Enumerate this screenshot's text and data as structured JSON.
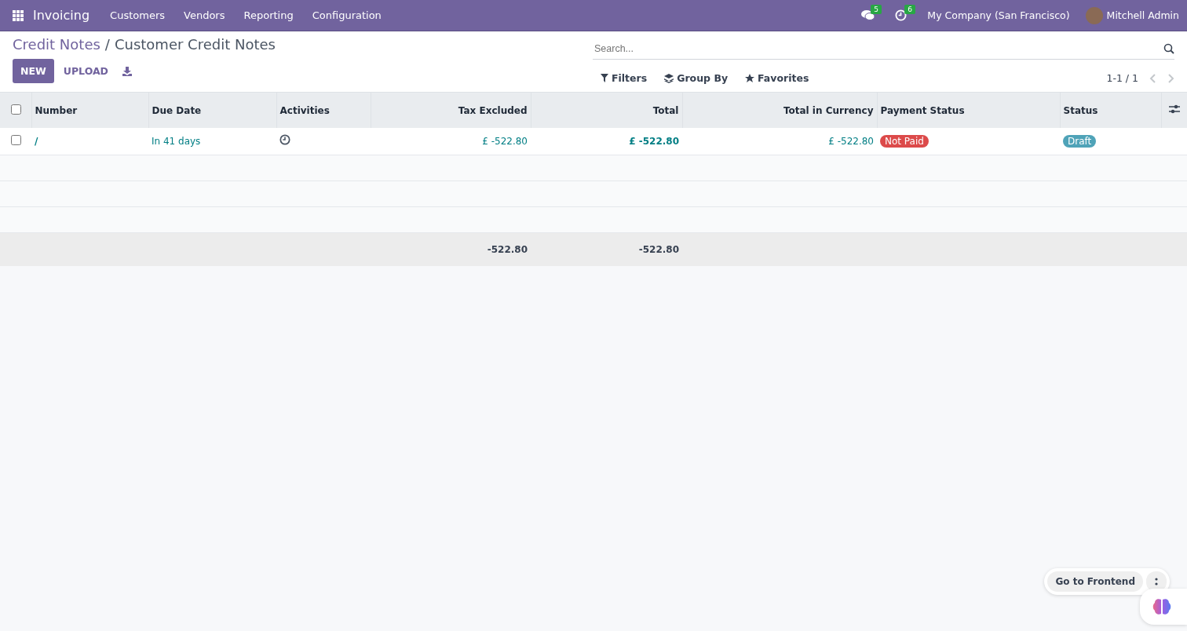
{
  "navbar": {
    "app_name": "Invoicing",
    "menu": [
      "Customers",
      "Vendors",
      "Reporting",
      "Configuration"
    ],
    "messages_count": "5",
    "activities_count": "6",
    "company": "My Company (San Francisco)",
    "user": "Mitchell Admin"
  },
  "breadcrumbs": [
    {
      "label": "Credit Notes",
      "selected": false
    },
    {
      "label": "Customer Credit Notes",
      "selected": true
    }
  ],
  "breadcrumb_separator": "/",
  "actions": {
    "new": "NEW",
    "upload": "UPLOAD"
  },
  "search": {
    "placeholder": "Search..."
  },
  "filters": [
    {
      "kind": "filter",
      "label": "Filters"
    },
    {
      "kind": "group",
      "label": "Group By"
    },
    {
      "kind": "favorite",
      "label": "Favorites"
    }
  ],
  "pager": "1-1 / 1",
  "table": {
    "select_all_checked": false,
    "columns": [
      "Number",
      "Due Date",
      "Activities",
      "Tax Excluded",
      "Total",
      "Total in Currency",
      "Payment Status",
      "Status"
    ],
    "rows": [
      {
        "checked": false,
        "number": "/",
        "due_date": "In 41 days",
        "tax_excluded": "£ -522.80",
        "total": "£ -522.80",
        "total_in_currency": "£ -522.80",
        "payment_status": {
          "label": "Not Paid",
          "color": "#dc4a4a"
        },
        "status": {
          "label": "Draft",
          "color": "#4fa3b8"
        }
      }
    ],
    "totals": {
      "tax_excluded": "-522.80",
      "total": "-522.80"
    }
  },
  "frontend_button": "Go to Frontend"
}
